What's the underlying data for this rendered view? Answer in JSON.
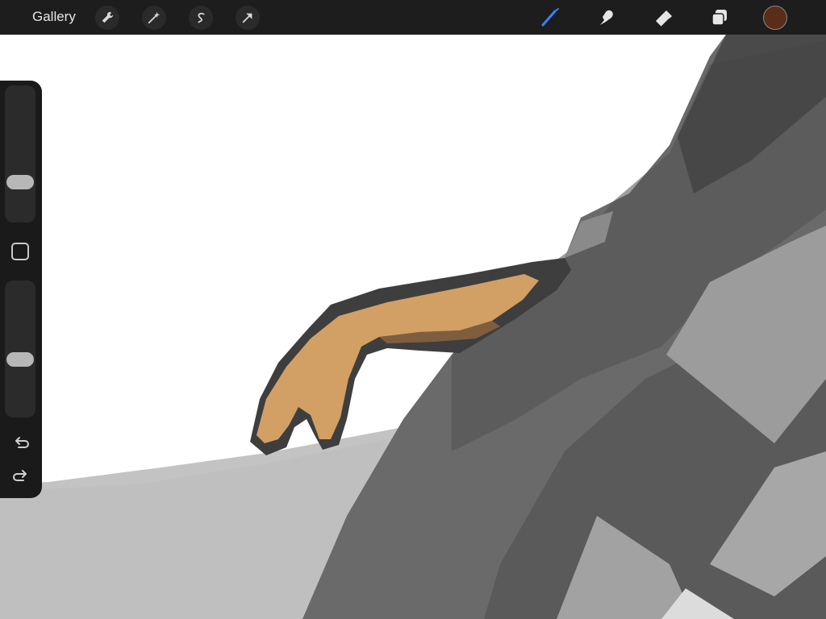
{
  "toolbar": {
    "gallery_label": "Gallery",
    "left_tools": [
      {
        "name": "actions",
        "icon": "wrench-icon"
      },
      {
        "name": "adjustments",
        "icon": "magic-wand-icon"
      },
      {
        "name": "selection",
        "icon": "selection-s-icon"
      },
      {
        "name": "transform",
        "icon": "arrow-cursor-icon"
      }
    ],
    "right_tools": [
      {
        "name": "brush",
        "icon": "paintbrush-icon",
        "active": true
      },
      {
        "name": "smudge",
        "icon": "finger-smudge-icon",
        "active": false
      },
      {
        "name": "eraser",
        "icon": "eraser-icon",
        "active": false
      },
      {
        "name": "layers",
        "icon": "layers-icon",
        "active": false
      }
    ],
    "current_color": "#5a2d18",
    "active_color": "#3b82f6"
  },
  "sidebar": {
    "brush_size_level": 0.26,
    "opacity_level": 0.41,
    "modify_icon": "square-outline-icon",
    "undo_icon": "undo-arrow-icon",
    "redo_icon": "redo-arrow-icon"
  },
  "canvas": {
    "background": "#ffffff",
    "colors": [
      "#c8c8c8",
      "#6e6e6e",
      "#444444",
      "#d4a067",
      "#3a3a3a"
    ]
  }
}
